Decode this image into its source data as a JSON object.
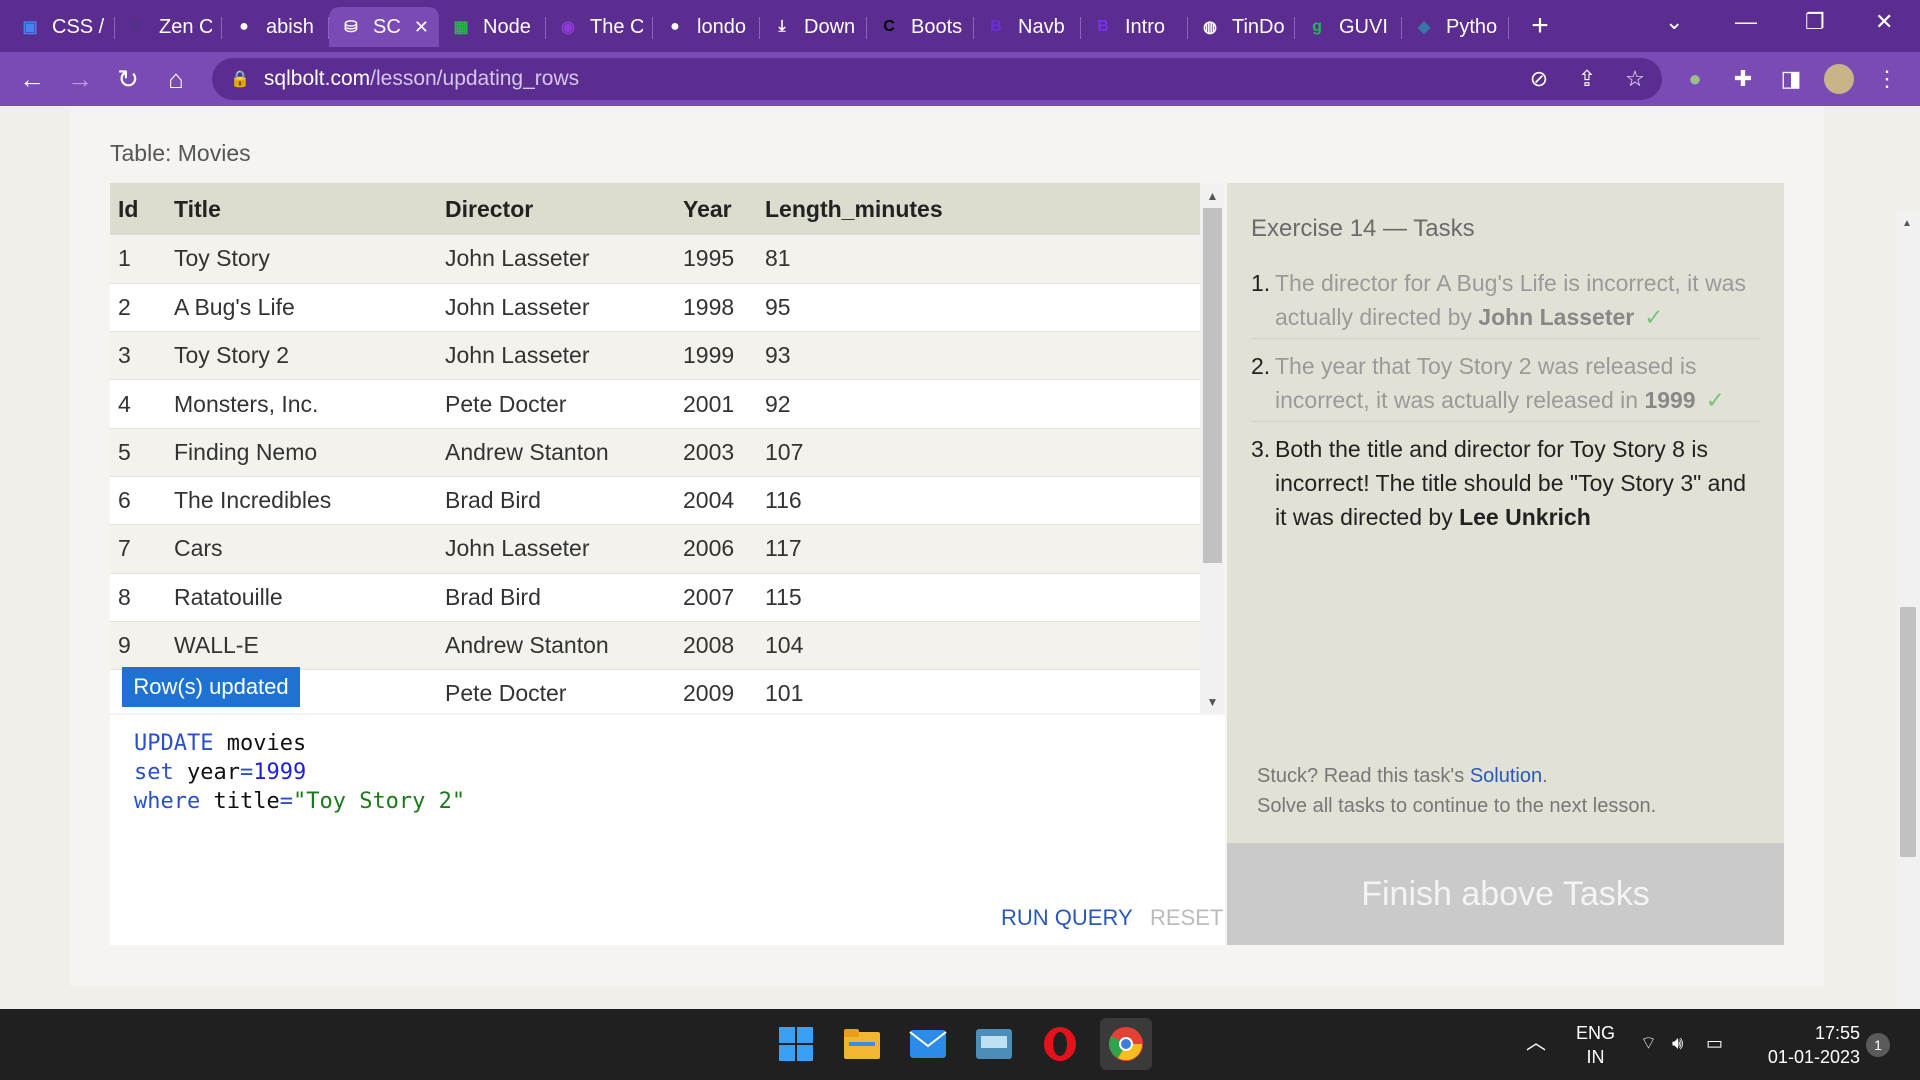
{
  "browser": {
    "tabs": [
      {
        "label": "CSS /",
        "icon": "google-slides-icon",
        "color": "#4285f4"
      },
      {
        "label": "Zen C",
        "icon": "zen-icon",
        "color": "#3b3b7a"
      },
      {
        "label": "abish",
        "icon": "github-icon",
        "color": "#ffffff"
      },
      {
        "label": "SC",
        "icon": "sqlbolt-icon",
        "color": "#ffffff",
        "active": true
      },
      {
        "label": "Node",
        "icon": "replit-icon",
        "color": "#2bb24c"
      },
      {
        "label": "The C",
        "icon": "brand-icon",
        "color": "#8b3dd6"
      },
      {
        "label": "londo",
        "icon": "github-icon",
        "color": "#ffffff"
      },
      {
        "label": "Down",
        "icon": "download-icon",
        "color": "#ffffff"
      },
      {
        "label": "Boots",
        "icon": "codecademy-icon",
        "color": "#000000"
      },
      {
        "label": "Navb",
        "icon": "bootstrap-icon",
        "color": "#6c2fd6"
      },
      {
        "label": "Intro",
        "icon": "bootstrap-icon",
        "color": "#7a2fe8"
      },
      {
        "label": "TinDo",
        "icon": "globe-icon",
        "color": "#ffffff"
      },
      {
        "label": "GUVI",
        "icon": "guvi-icon",
        "color": "#1db954"
      },
      {
        "label": "Pytho",
        "icon": "python-icon",
        "color": "#3776ab"
      }
    ],
    "url_host": "sqlbolt.com",
    "url_path": "/lesson/updating_rows"
  },
  "lesson": {
    "table_caption": "Table: Movies",
    "columns": [
      "Id",
      "Title",
      "Director",
      "Year",
      "Length_minutes"
    ],
    "rows": [
      [
        "1",
        "Toy Story",
        "John Lasseter",
        "1995",
        "81"
      ],
      [
        "2",
        "A Bug's Life",
        "John Lasseter",
        "1998",
        "95"
      ],
      [
        "3",
        "Toy Story 2",
        "John Lasseter",
        "1999",
        "93"
      ],
      [
        "4",
        "Monsters, Inc.",
        "Pete Docter",
        "2001",
        "92"
      ],
      [
        "5",
        "Finding Nemo",
        "Andrew Stanton",
        "2003",
        "107"
      ],
      [
        "6",
        "The Incredibles",
        "Brad Bird",
        "2004",
        "116"
      ],
      [
        "7",
        "Cars",
        "John Lasseter",
        "2006",
        "117"
      ],
      [
        "8",
        "Ratatouille",
        "Brad Bird",
        "2007",
        "115"
      ],
      [
        "9",
        "WALL-E",
        "Andrew Stanton",
        "2008",
        "104"
      ],
      [
        "",
        "",
        "Pete Docter",
        "2009",
        "101"
      ]
    ],
    "toast": "Row(s) updated",
    "query": {
      "line1_kw": "UPDATE",
      "line1_rest": " movies",
      "line2_kw": "set",
      "line2_col": " year",
      "line2_eq": "=",
      "line2_num": "1999",
      "line3_kw": "where",
      "line3_col": " title",
      "line3_eq": "=",
      "line3_str": "\"Toy Story 2\""
    },
    "run_label": "RUN QUERY",
    "reset_label": "RESET"
  },
  "tasks": {
    "title": "Exercise 14 — Tasks",
    "items": [
      {
        "num": "1.",
        "text": "The director for A Bug's Life is incorrect, it was actually directed by ",
        "bold": "John Lasseter",
        "done": true
      },
      {
        "num": "2.",
        "text": "The year that Toy Story 2 was released is incorrect, it was actually released in ",
        "bold": "1999",
        "done": true
      },
      {
        "num": "3.",
        "text": "Both the title and director for Toy Story 8 is incorrect! The title should be \"Toy Story 3\" and it was directed by ",
        "bold": "Lee Unkrich",
        "done": false
      }
    ],
    "check": "✓",
    "stuck_prefix": "Stuck? Read this task's ",
    "solution_link": "Solution",
    "stuck_suffix": ".",
    "stuck_line2": "Solve all tasks to continue to the next lesson.",
    "finish_label": "Finish above Tasks"
  },
  "taskbar": {
    "lang1": "ENG",
    "lang2": "IN",
    "time": "17:55",
    "date": "01-01-2023",
    "notif_count": "1"
  }
}
